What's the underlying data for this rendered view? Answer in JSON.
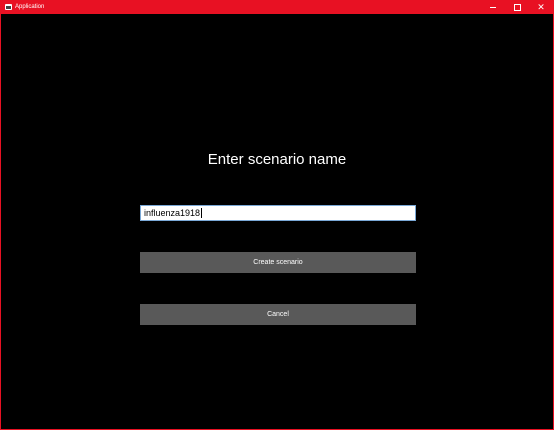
{
  "window": {
    "title": "Application",
    "accent": "#e81123",
    "controls": {
      "minimize": "minimize-icon",
      "maximize": "maximize-icon",
      "close": "close-icon"
    }
  },
  "dialog": {
    "heading": "Enter scenario name",
    "input_value": "influenza1918",
    "create_label": "Create scenario",
    "cancel_label": "Cancel"
  },
  "colors": {
    "background": "#000000",
    "button": "#595959",
    "input_border": "#7aa8d6"
  }
}
